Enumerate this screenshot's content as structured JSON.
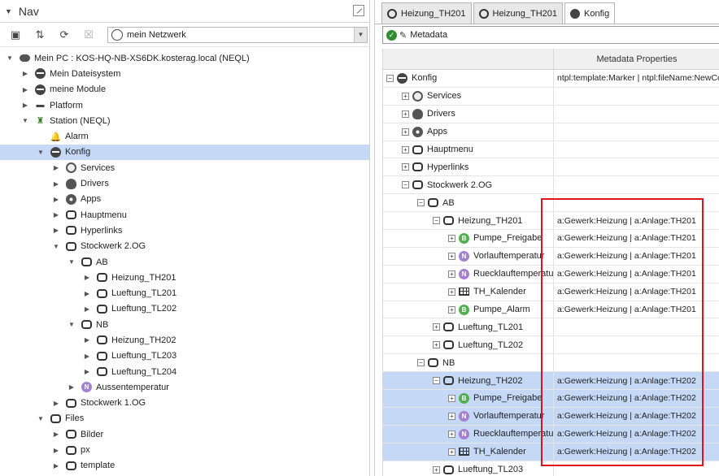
{
  "nav": {
    "title": "Nav",
    "network_select": "mein Netzwerk",
    "tree": [
      {
        "label": "Mein PC : KOS-HQ-NB-XS6DK.kosterag.local (NEQL)",
        "depth": 0,
        "tw": "down",
        "icon": "pc"
      },
      {
        "label": "Mein Dateisystem",
        "depth": 1,
        "tw": "right",
        "icon": "db"
      },
      {
        "label": "meine Module",
        "depth": 1,
        "tw": "right",
        "icon": "db"
      },
      {
        "label": "Platform",
        "depth": 1,
        "tw": "right",
        "icon": "plat"
      },
      {
        "label": "Station (NEQL)",
        "depth": 1,
        "tw": "down",
        "icon": "station"
      },
      {
        "label": "Alarm",
        "depth": 2,
        "tw": "none",
        "icon": "bell"
      },
      {
        "label": "Konfig",
        "depth": 2,
        "tw": "down",
        "icon": "db",
        "selected": true
      },
      {
        "label": "Services",
        "depth": 3,
        "tw": "right",
        "icon": "svc"
      },
      {
        "label": "Drivers",
        "depth": 3,
        "tw": "right",
        "icon": "drv"
      },
      {
        "label": "Apps",
        "depth": 3,
        "tw": "right",
        "icon": "globe2"
      },
      {
        "label": "Hauptmenu",
        "depth": 3,
        "tw": "right",
        "icon": "folder"
      },
      {
        "label": "Hyperlinks",
        "depth": 3,
        "tw": "right",
        "icon": "folder"
      },
      {
        "label": "Stockwerk 2.OG",
        "depth": 3,
        "tw": "down",
        "icon": "folder"
      },
      {
        "label": "AB",
        "depth": 4,
        "tw": "down",
        "icon": "folder"
      },
      {
        "label": "Heizung_TH201",
        "depth": 5,
        "tw": "right",
        "icon": "folder"
      },
      {
        "label": "Lueftung_TL201",
        "depth": 5,
        "tw": "right",
        "icon": "folder"
      },
      {
        "label": "Lueftung_TL202",
        "depth": 5,
        "tw": "right",
        "icon": "folder"
      },
      {
        "label": "NB",
        "depth": 4,
        "tw": "down",
        "icon": "folder"
      },
      {
        "label": "Heizung_TH202",
        "depth": 5,
        "tw": "right",
        "icon": "folder"
      },
      {
        "label": "Lueftung_TL203",
        "depth": 5,
        "tw": "right",
        "icon": "folder"
      },
      {
        "label": "Lueftung_TL204",
        "depth": 5,
        "tw": "right",
        "icon": "folder"
      },
      {
        "label": "Aussentemperatur",
        "depth": 4,
        "tw": "right",
        "icon": "circ-N"
      },
      {
        "label": "Stockwerk 1.OG",
        "depth": 3,
        "tw": "right",
        "icon": "folder"
      },
      {
        "label": "Files",
        "depth": 2,
        "tw": "down",
        "icon": "folder"
      },
      {
        "label": "Bilder",
        "depth": 3,
        "tw": "right",
        "icon": "folder"
      },
      {
        "label": "px",
        "depth": 3,
        "tw": "right",
        "icon": "folder"
      },
      {
        "label": "template",
        "depth": 3,
        "tw": "right",
        "icon": "folder"
      }
    ]
  },
  "tabs": [
    {
      "label": "Heizung_TH201",
      "icon": "folder"
    },
    {
      "label": "Heizung_TH201",
      "icon": "folder"
    },
    {
      "label": "Konfig",
      "icon": "db",
      "active": true
    }
  ],
  "metadata_toolbar": {
    "label": "Metadata"
  },
  "table": {
    "header": "Metadata Properties",
    "rows": [
      {
        "label": "Konfig",
        "depth": 0,
        "pm": "-",
        "icon": "db",
        "meta": "ntpl:template:Marker | ntpl:fileName:NewControllerFile"
      },
      {
        "label": "Services",
        "depth": 1,
        "pm": "+",
        "icon": "svc",
        "meta": ""
      },
      {
        "label": "Drivers",
        "depth": 1,
        "pm": "+",
        "icon": "drv",
        "meta": ""
      },
      {
        "label": "Apps",
        "depth": 1,
        "pm": "+",
        "icon": "globe2",
        "meta": ""
      },
      {
        "label": "Hauptmenu",
        "depth": 1,
        "pm": "+",
        "icon": "folder",
        "meta": ""
      },
      {
        "label": "Hyperlinks",
        "depth": 1,
        "pm": "+",
        "icon": "folder",
        "meta": ""
      },
      {
        "label": "Stockwerk 2.OG",
        "depth": 1,
        "pm": "-",
        "icon": "folder",
        "meta": ""
      },
      {
        "label": "AB",
        "depth": 2,
        "pm": "-",
        "icon": "folder",
        "meta": ""
      },
      {
        "label": "Heizung_TH201",
        "depth": 3,
        "pm": "-",
        "icon": "folder",
        "meta": "a:Gewerk:Heizung | a:Anlage:TH201"
      },
      {
        "label": "Pumpe_Freigabe",
        "depth": 4,
        "pm": "+",
        "icon": "circ-B",
        "meta": "a:Gewerk:Heizung | a:Anlage:TH201"
      },
      {
        "label": "Vorlauftemperatur",
        "depth": 4,
        "pm": "+",
        "icon": "circ-N",
        "meta": "a:Gewerk:Heizung | a:Anlage:TH201"
      },
      {
        "label": "Ruecklauftemperatur",
        "depth": 4,
        "pm": "+",
        "icon": "circ-N",
        "meta": "a:Gewerk:Heizung | a:Anlage:TH201"
      },
      {
        "label": "TH_Kalender",
        "depth": 4,
        "pm": "+",
        "icon": "grid",
        "meta": "a:Gewerk:Heizung | a:Anlage:TH201"
      },
      {
        "label": "Pumpe_Alarm",
        "depth": 4,
        "pm": "+",
        "icon": "circ-B",
        "meta": "a:Gewerk:Heizung | a:Anlage:TH201"
      },
      {
        "label": "Lueftung_TL201",
        "depth": 3,
        "pm": "+",
        "icon": "folder",
        "meta": ""
      },
      {
        "label": "Lueftung_TL202",
        "depth": 3,
        "pm": "+",
        "icon": "folder",
        "meta": ""
      },
      {
        "label": "NB",
        "depth": 2,
        "pm": "-",
        "icon": "folder",
        "meta": ""
      },
      {
        "label": "Heizung_TH202",
        "depth": 3,
        "pm": "-",
        "icon": "folder",
        "meta": "a:Gewerk:Heizung | a:Anlage:TH202",
        "selected": true
      },
      {
        "label": "Pumpe_Freigabe",
        "depth": 4,
        "pm": "+",
        "icon": "circ-B",
        "meta": "a:Gewerk:Heizung | a:Anlage:TH202",
        "selected": true
      },
      {
        "label": "Vorlauftemperatur",
        "depth": 4,
        "pm": "+",
        "icon": "circ-N",
        "meta": "a:Gewerk:Heizung | a:Anlage:TH202",
        "selected": true
      },
      {
        "label": "Ruecklauftemperatur",
        "depth": 4,
        "pm": "+",
        "icon": "circ-N",
        "meta": "a:Gewerk:Heizung | a:Anlage:TH202",
        "selected": true
      },
      {
        "label": "TH_Kalender",
        "depth": 4,
        "pm": "+",
        "icon": "grid",
        "meta": "a:Gewerk:Heizung | a:Anlage:TH202",
        "selected": true
      },
      {
        "label": "Lueftung_TL203",
        "depth": 3,
        "pm": "+",
        "icon": "folder",
        "meta": ""
      }
    ]
  },
  "colors": {
    "selection": "#c5d9f7",
    "highlight_box": "#e0141e"
  }
}
